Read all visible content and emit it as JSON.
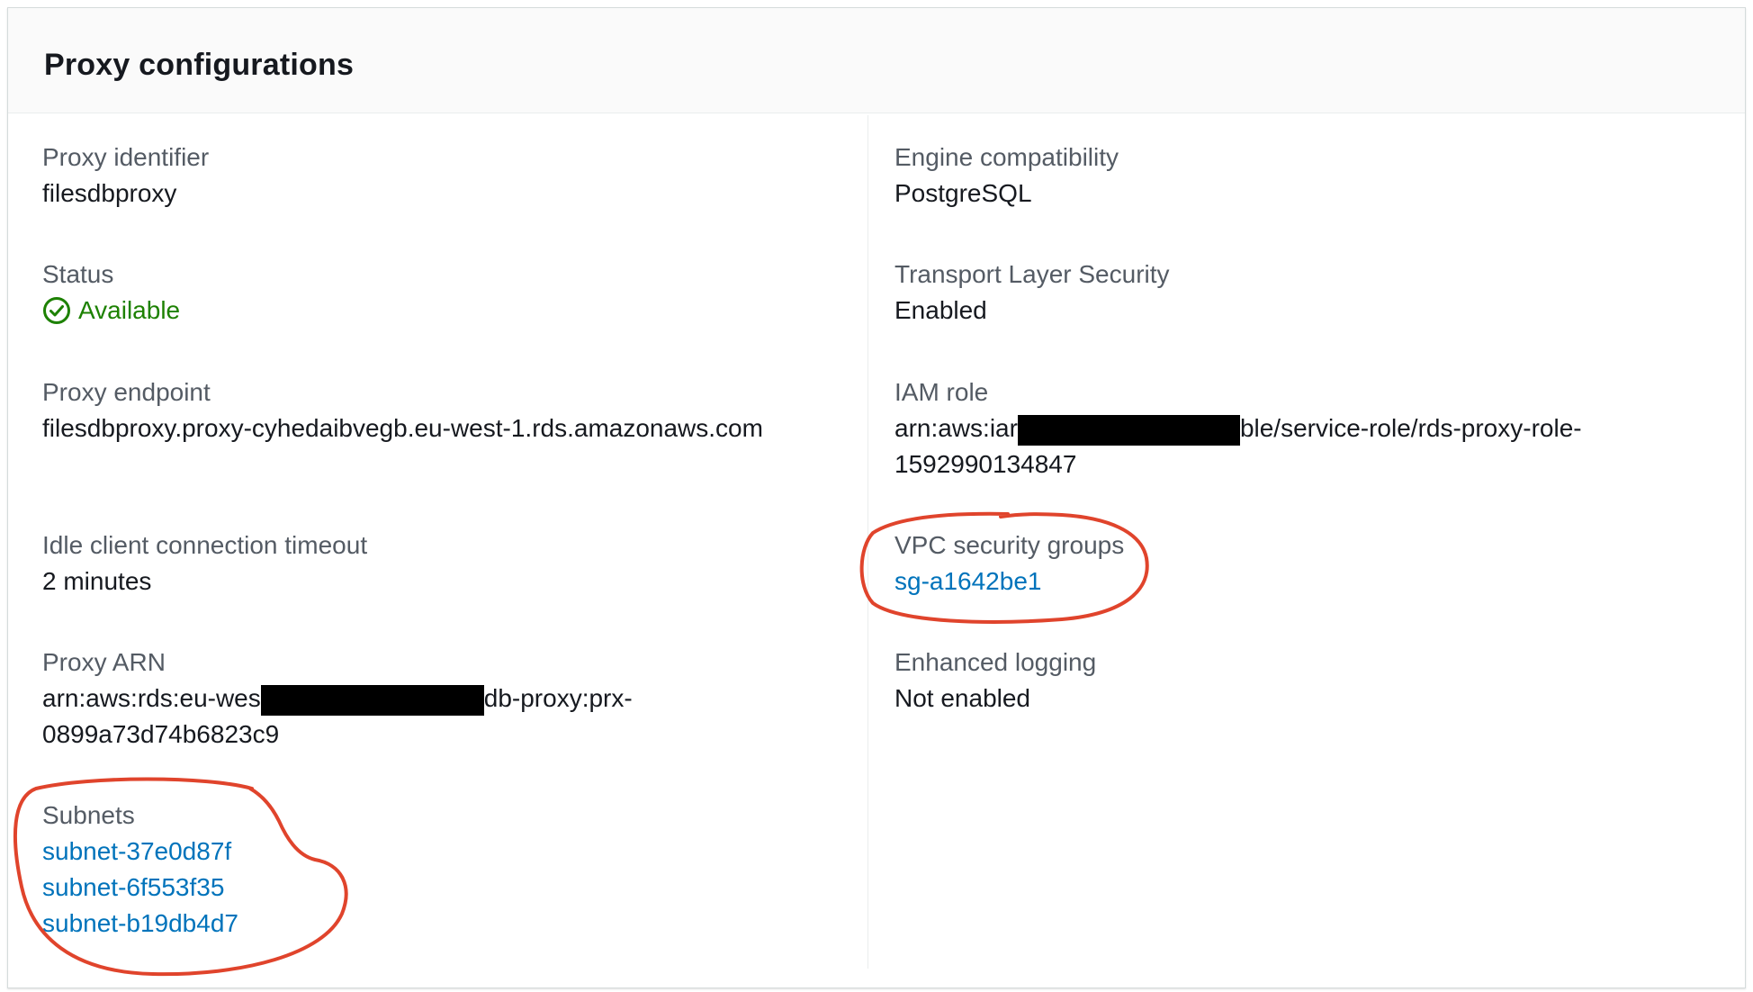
{
  "panel": {
    "title": "Proxy configurations"
  },
  "fields": {
    "proxy_identifier": {
      "label": "Proxy identifier",
      "value": "filesdbproxy"
    },
    "status": {
      "label": "Status",
      "value": "Available",
      "icon": "check-circle-icon",
      "color": "#1d8102"
    },
    "proxy_endpoint": {
      "label": "Proxy endpoint",
      "value": "filesdbproxy.proxy-cyhedaibvegb.eu-west-1.rds.amazonaws.com"
    },
    "idle_timeout": {
      "label": "Idle client connection timeout",
      "value": "2 minutes"
    },
    "proxy_arn": {
      "label": "Proxy ARN",
      "value_start": "arn:aws:rds:eu-wes",
      "value_end": "db-proxy:prx-",
      "value_line2": "0899a73d74b6823c9"
    },
    "subnets": {
      "label": "Subnets",
      "items": [
        "subnet-37e0d87f",
        "subnet-6f553f35",
        "subnet-b19db4d7"
      ]
    },
    "engine": {
      "label": "Engine compatibility",
      "value": "PostgreSQL"
    },
    "tls": {
      "label": "Transport Layer Security",
      "value": "Enabled"
    },
    "iam_role": {
      "label": "IAM role",
      "value_start": "arn:aws:iar",
      "value_end": "ble/service-role/rds-proxy-role-",
      "value_line2": "1592990134847"
    },
    "vpc_sg": {
      "label": "VPC security groups",
      "items": [
        "sg-a1642be1"
      ]
    },
    "enhanced_logging": {
      "label": "Enhanced logging",
      "value": "Not enabled"
    }
  },
  "colors": {
    "link": "#0073bb",
    "annotation": "#e0442c",
    "success": "#1d8102"
  }
}
